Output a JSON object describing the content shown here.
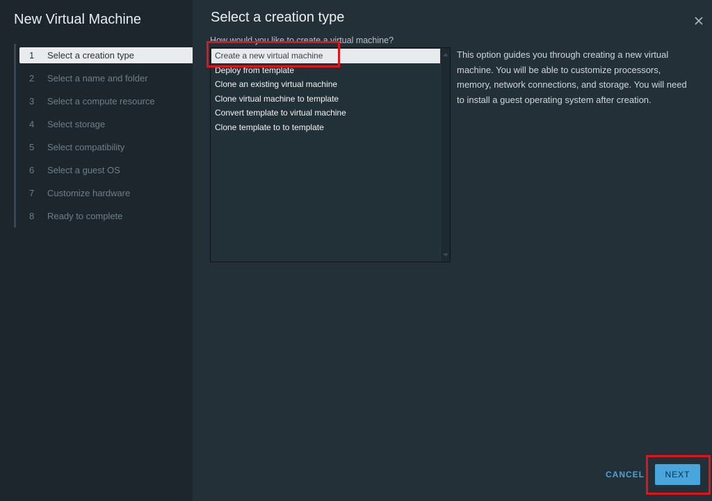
{
  "sidebar": {
    "title": "New Virtual Machine",
    "steps": [
      {
        "num": "1",
        "label": "Select a creation type"
      },
      {
        "num": "2",
        "label": "Select a name and folder"
      },
      {
        "num": "3",
        "label": "Select a compute resource"
      },
      {
        "num": "4",
        "label": "Select storage"
      },
      {
        "num": "5",
        "label": "Select compatibility"
      },
      {
        "num": "6",
        "label": "Select a guest OS"
      },
      {
        "num": "7",
        "label": "Customize hardware"
      },
      {
        "num": "8",
        "label": "Ready to complete"
      }
    ]
  },
  "main": {
    "title": "Select a creation type",
    "question": "How would you like to create a virtual machine?",
    "options": [
      "Create a new virtual machine",
      "Deploy from template",
      "Clone an existing virtual machine",
      "Clone virtual machine to template",
      "Convert template to virtual machine",
      "Clone template to to template"
    ],
    "selected_option": "Create a new virtual machine",
    "description": "This option guides you through creating a new virtual machine. You will be able to customize processors, memory, network connections, and storage. You will need to install a guest operating system after creation."
  },
  "footer": {
    "cancel_label": "CANCEL",
    "next_label": "NEXT"
  },
  "colors": {
    "background": "#243038",
    "sidebar": "#1d262d",
    "accent": "#48a6dc",
    "highlight": "#e2141b"
  }
}
